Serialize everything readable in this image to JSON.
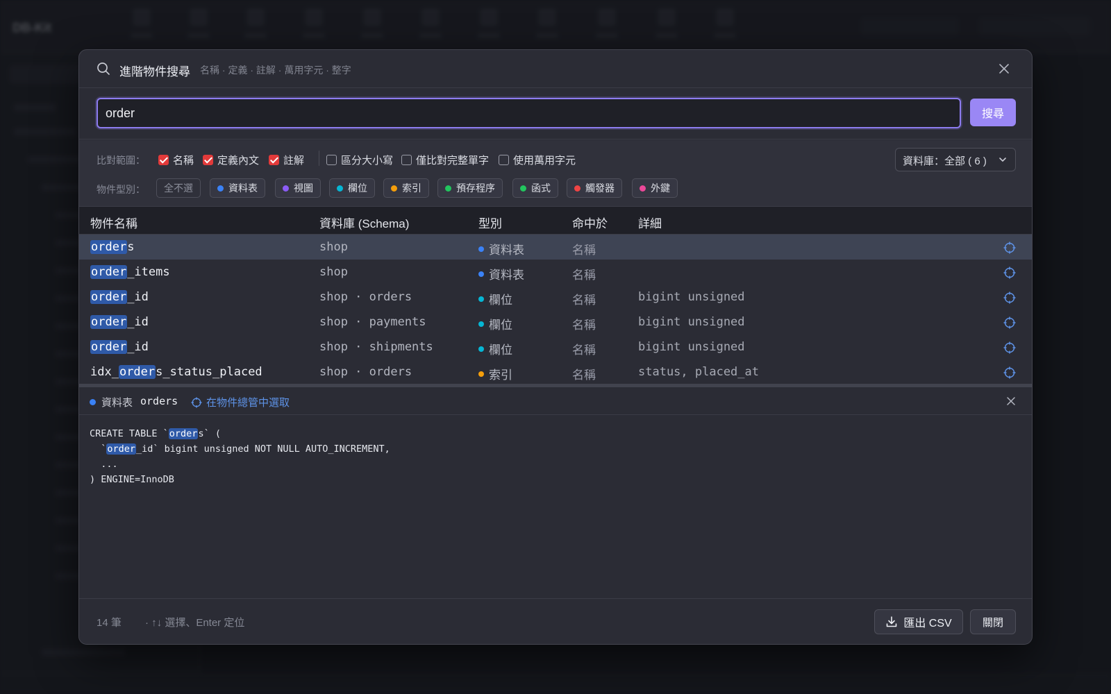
{
  "background": {
    "brand": "DB-Kit"
  },
  "modal": {
    "title": "進階物件搜尋",
    "subtitle": "名稱 · 定義 · 註解 · 萬用字元 · 整字",
    "search": {
      "value": "order",
      "button_label": "搜尋"
    },
    "filters": {
      "scope_label": "比對範圍：",
      "scope_options": [
        {
          "label": "名稱",
          "checked": true
        },
        {
          "label": "定義內文",
          "checked": true
        },
        {
          "label": "註解",
          "checked": true
        },
        {
          "label": "區分大小寫",
          "checked": false
        },
        {
          "label": "僅比對完整單字",
          "checked": false
        },
        {
          "label": "使用萬用字元",
          "checked": false
        }
      ],
      "database_select": "資料庫：全部 ( 6 )",
      "type_label": "物件型別：",
      "clear_all": "全不選",
      "types": [
        {
          "label": "資料表",
          "color": "#3b82f6"
        },
        {
          "label": "視圖",
          "color": "#8b5cf6"
        },
        {
          "label": "欄位",
          "color": "#06b6d4"
        },
        {
          "label": "索引",
          "color": "#f59e0b"
        },
        {
          "label": "預存程序",
          "color": "#22c55e"
        },
        {
          "label": "函式",
          "color": "#22c55e"
        },
        {
          "label": "觸發器",
          "color": "#ef4444"
        },
        {
          "label": "外鍵",
          "color": "#ec4899"
        }
      ]
    },
    "table": {
      "headers": [
        "物件名稱",
        "資料庫 (Schema)",
        "型別",
        "命中於",
        "詳細"
      ],
      "rows": [
        {
          "name_pre": "",
          "name_hl": "order",
          "name_post": "s",
          "schema": "shop",
          "type": "資料表",
          "type_color": "#3b82f6",
          "hit": "名稱",
          "detail": "",
          "selected": true
        },
        {
          "name_pre": "",
          "name_hl": "order",
          "name_post": "_items",
          "schema": "shop",
          "type": "資料表",
          "type_color": "#3b82f6",
          "hit": "名稱",
          "detail": "",
          "selected": false
        },
        {
          "name_pre": "",
          "name_hl": "order",
          "name_post": "_id",
          "schema": "shop · orders",
          "type": "欄位",
          "type_color": "#06b6d4",
          "hit": "名稱",
          "detail": "bigint unsigned",
          "selected": false
        },
        {
          "name_pre": "",
          "name_hl": "order",
          "name_post": "_id",
          "schema": "shop · payments",
          "type": "欄位",
          "type_color": "#06b6d4",
          "hit": "名稱",
          "detail": "bigint unsigned",
          "selected": false
        },
        {
          "name_pre": "",
          "name_hl": "order",
          "name_post": "_id",
          "schema": "shop · shipments",
          "type": "欄位",
          "type_color": "#06b6d4",
          "hit": "名稱",
          "detail": "bigint unsigned",
          "selected": false
        },
        {
          "name_pre": "idx_",
          "name_hl": "order",
          "name_post": "s_status_placed",
          "schema": "shop · orders",
          "type": "索引",
          "type_color": "#f59e0b",
          "hit": "名稱",
          "detail": "status, placed_at",
          "selected": false
        }
      ]
    },
    "detail": {
      "type": "資料表",
      "type_color": "#3b82f6",
      "name": "orders",
      "locate_link": "在物件總管中選取",
      "code_lines": [
        {
          "pre": "CREATE TABLE `",
          "hl": "order",
          "post": "s` ("
        },
        {
          "pre": "  `",
          "hl": "order",
          "post": "_id` bigint unsigned NOT NULL AUTO_INCREMENT,"
        },
        {
          "pre": "  ...",
          "hl": "",
          "post": ""
        },
        {
          "pre": ") ENGINE=InnoDB",
          "hl": "",
          "post": ""
        }
      ]
    },
    "footer": {
      "count": "14 筆",
      "hint": "·   ↑↓ 選擇、Enter 定位",
      "export_label": "匯出 CSV",
      "close_label": "關閉"
    }
  }
}
